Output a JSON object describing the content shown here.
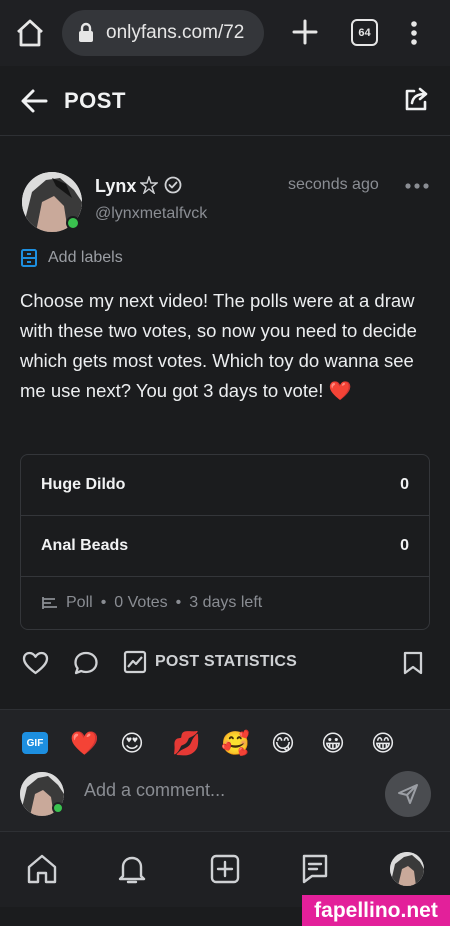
{
  "browser": {
    "url": "onlyfans.com/72",
    "tab_count": "64"
  },
  "header": {
    "title": "POST"
  },
  "post": {
    "author_name": "Lynx",
    "author_handle": "@lynxmetalfvck",
    "timestamp": "seconds ago",
    "labels_action": "Add labels",
    "text": "Choose my next video! The polls were at a draw with these two votes, so now you need to decide which gets most votes. Which toy do wanna see me use next? You got 3 days to vote! ❤️"
  },
  "poll": {
    "options": [
      {
        "label": "Huge Dildo",
        "count": "0"
      },
      {
        "label": "Anal Beads",
        "count": "0"
      }
    ],
    "type_label": "Poll",
    "votes_label": "0 Votes",
    "time_left": "3 days left"
  },
  "actions": {
    "stats_label": "POST STATISTICS"
  },
  "comment": {
    "gif_label": "GIF",
    "emojis": [
      "❤️",
      "😍",
      "💋",
      "🥰",
      "😋",
      "😀",
      "😁"
    ],
    "placeholder": "Add a comment..."
  },
  "watermark": "fapellino.net",
  "colors": {
    "background": "#1b1c1e",
    "accent_blue": "#1d8fe0",
    "online_green": "#3ac24f",
    "watermark_pink": "#e3209a"
  }
}
